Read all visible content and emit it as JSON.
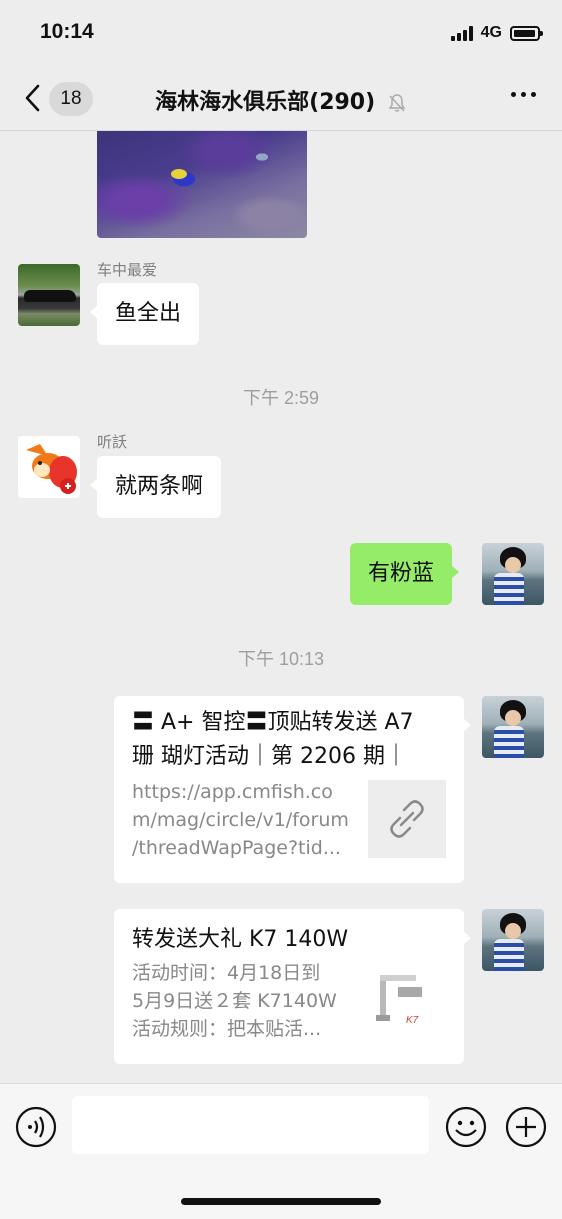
{
  "status_bar": {
    "time": "10:14",
    "network": "4G"
  },
  "nav": {
    "unread_count": "18",
    "title": "海林海水俱乐部(290)"
  },
  "messages": [
    {
      "type": "image",
      "side": "left",
      "description_icon": "fish-tank-photo"
    },
    {
      "type": "text",
      "side": "left",
      "sender": "车中最爱",
      "text": "鱼全出"
    },
    {
      "type": "timestamp",
      "text": "下午 2:59"
    },
    {
      "type": "text",
      "side": "left",
      "sender": "听訞",
      "text": "就两条啊"
    },
    {
      "type": "text",
      "side": "right",
      "text": "有粉蓝"
    },
    {
      "type": "timestamp",
      "text": "下午 10:13"
    },
    {
      "type": "link",
      "side": "right",
      "title_line1": "〓 A+ 智控〓顶贴转发送 A7",
      "title_line2": "珊 瑚灯活动｜第 2206 期｜",
      "desc_lines": [
        "https://app.cmfish.co",
        "m/mag/circle/v1/forum",
        "/threadWapPage?tid..."
      ]
    },
    {
      "type": "link",
      "side": "right",
      "title_line1": "转发送大礼 K7 140W",
      "desc_lines": [
        "活动时间：4月18日到",
        "5月9日送２套 K7140W",
        "活动规则：把本贴活..."
      ]
    }
  ],
  "input": {
    "placeholder": ""
  },
  "colors": {
    "background": "#ededed",
    "self_bubble": "#95ec69",
    "other_bubble": "#ffffff",
    "input_bar": "#f6f6f6"
  },
  "icons": [
    "back-icon",
    "mute-icon",
    "more-icon",
    "link-icon",
    "voice-icon",
    "emoji-icon",
    "plus-icon"
  ]
}
